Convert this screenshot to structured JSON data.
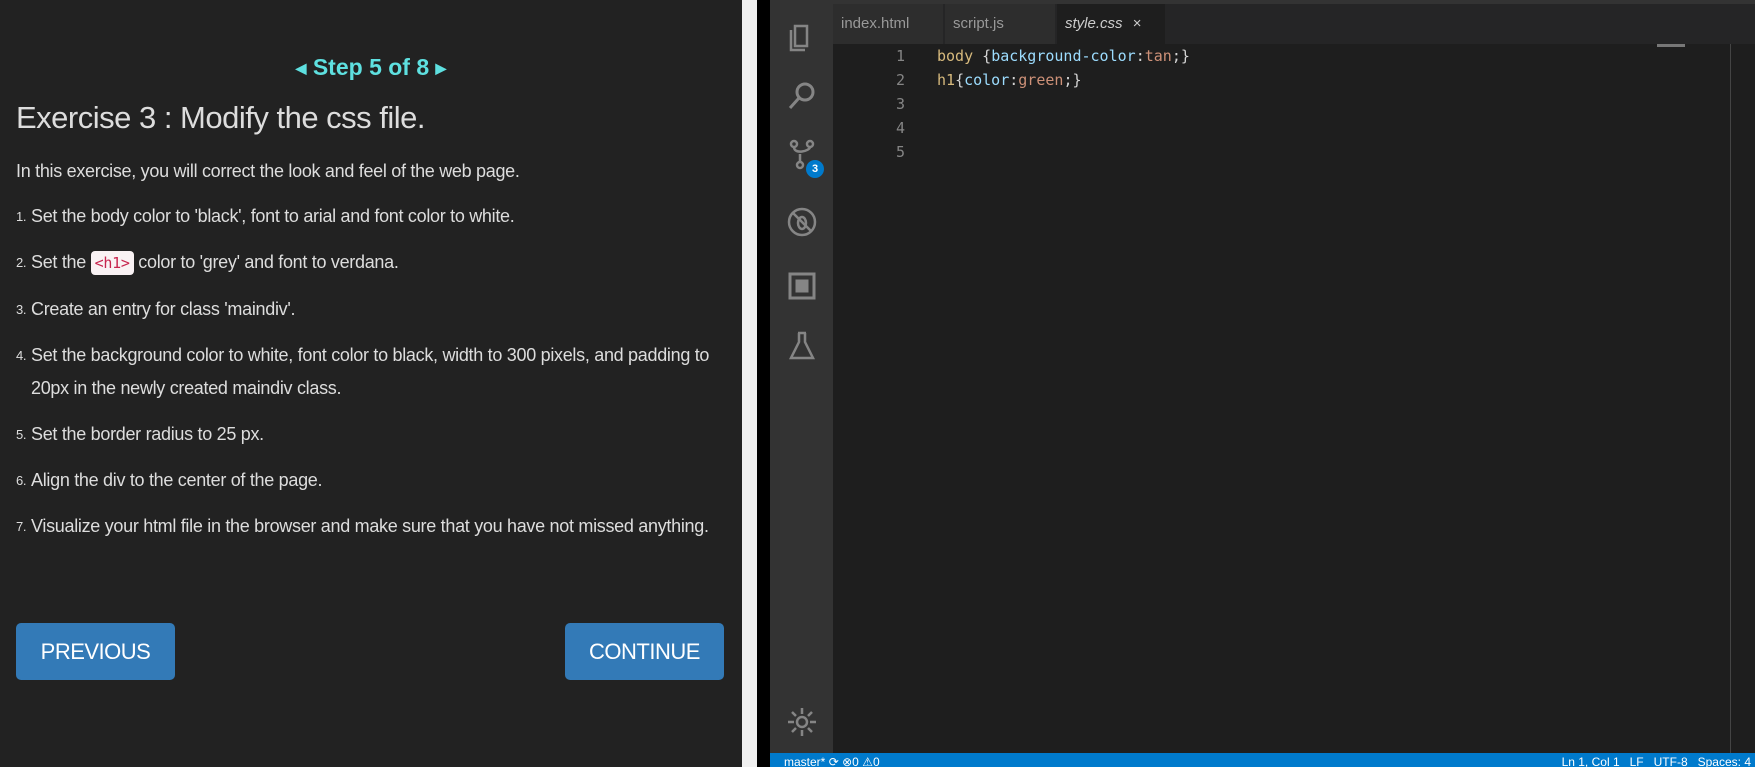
{
  "tutorial": {
    "step": "Step 5 of 8",
    "title": "Exercise 3 : Modify the css file.",
    "intro": "In this exercise, you will correct the look and feel of the web page.",
    "items": [
      {
        "n": "1.",
        "text": "Set the body color to 'black', font to arial and font color to white."
      },
      {
        "n": "2.",
        "pre": "Set the ",
        "code": "<h1>",
        "post": " color to 'grey' and font to verdana."
      },
      {
        "n": "3.",
        "text": "Create an entry for class 'maindiv'."
      },
      {
        "n": "4.",
        "text": "Set the background color to white, font color to black, width to 300 pixels, and padding to 20px in the newly created maindiv class."
      },
      {
        "n": "5.",
        "text": "Set the border radius to 25 px."
      },
      {
        "n": "6.",
        "text": "Align the div to the center of the page."
      },
      {
        "n": "7.",
        "text": "Visualize your html file in the browser and make sure that you have not missed anything."
      }
    ],
    "previous": "PREVIOUS",
    "continue": "CONTINUE",
    "accent": "#5ee0e0",
    "button_color": "#337ab7"
  },
  "editor": {
    "tabs": [
      {
        "label": "index.html"
      },
      {
        "label": "script.js"
      },
      {
        "label": "style.css",
        "active": true
      }
    ],
    "close": "×",
    "scm_badge": "3",
    "lines": [
      {
        "n": "1",
        "sel": "body",
        "open": " {",
        "prop": "background-color",
        "colon": ":",
        "val": "tan",
        "end": ";}"
      },
      {
        "n": "2",
        "sel": "h1",
        "open": "{",
        "prop": "color",
        "colon": ":",
        "val": "green",
        "end": ";}"
      },
      {
        "n": "3"
      },
      {
        "n": "4"
      },
      {
        "n": "5"
      }
    ],
    "status": {
      "branch": "master*",
      "errors": "0",
      "warnings": "0",
      "right": "Ln 1, Col 1   LF   UTF-8   Spaces: 4"
    }
  }
}
